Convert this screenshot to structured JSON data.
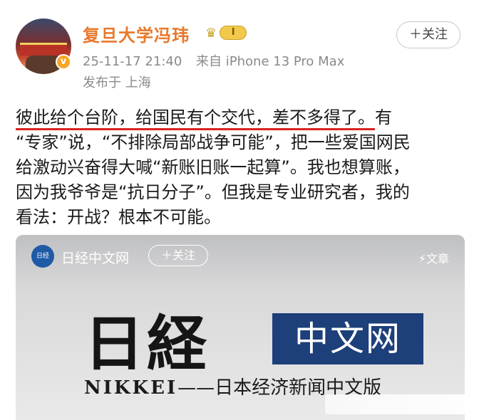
{
  "header": {
    "username": "复旦大学冯玮",
    "level_crown": "♛",
    "level_label": "I",
    "verified_mark": "v",
    "follow_label": "＋关注",
    "timestamp": "25-11-17 21:40",
    "source": "来自 iPhone 13 Pro Max",
    "location": "发布于 上海"
  },
  "post": {
    "line1_underlined": "彼此给个台阶，给国民有个交代，差不多得了。",
    "line1_rest": "有",
    "line2": "“专家”说，“不排除局部战争可能”，把一些爱国网民",
    "line3": "给激动兴奋得大喊“新账旧账一起算”。我也想算账，",
    "line4": "因为我爷爷是“抗日分子”。但我是专业研究者，我的",
    "line5": "看法：开战？根本不可能。"
  },
  "card": {
    "logo_text": "日经",
    "account_name": "日经中文网",
    "follow_label": "＋关注",
    "article_label": "⚡文章",
    "brand_kanji": "日経",
    "brand_cn": "中文网",
    "brand_latin": "NIKKEI",
    "brand_sub": "——日本经济新闻中文版"
  },
  "colors": {
    "username": "#e8782a",
    "underline": "#d9231f",
    "cn_box": "#1d3f7a"
  }
}
